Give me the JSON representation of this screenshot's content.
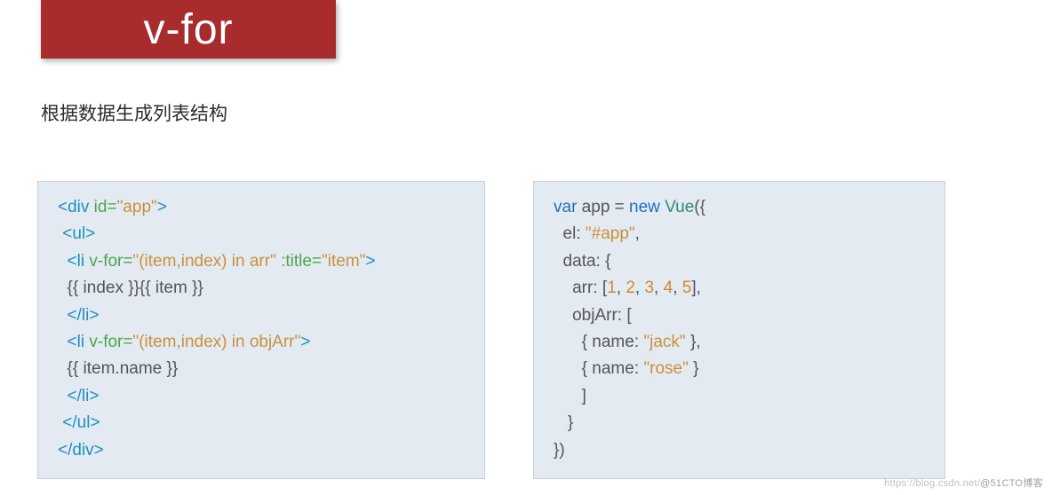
{
  "title": "v-for",
  "subtitle": "根据数据生成列表结构",
  "code_left": {
    "l1_open": "<div ",
    "l1_attr": "id=",
    "l1_str": "\"app\"",
    "l1_close": ">",
    "l2": " <ul>",
    "l3_open": "  <li ",
    "l3_attr1": "v-for=",
    "l3_str1": "\"(item,index) in arr\"",
    "l3_sp": " ",
    "l3_attr2": ":title=",
    "l3_str2": "\"item\"",
    "l3_close": ">",
    "l4": "  {{ index }}{{ item }}",
    "l5": "  </li>",
    "l6_open": "  <li ",
    "l6_attr": "v-for=",
    "l6_str": "\"(item,index) in objArr\"",
    "l6_close": ">",
    "l7": "  {{ item.name }}",
    "l8": "  </li>",
    "l9": " </ul>",
    "l10": "</div>"
  },
  "code_right": {
    "l1_kw1": "var",
    "l1_sp1": " app = ",
    "l1_kw2": "new",
    "l1_sp2": " ",
    "l1_cls": "Vue",
    "l1_end": "({",
    "l2_a": "  el: ",
    "l2_b": "\"#app\"",
    "l2_c": ",",
    "l3": "  data: {",
    "l4_a": "    arr: [",
    "l4_n1": "1",
    "l4_c1": ", ",
    "l4_n2": "2",
    "l4_c2": ", ",
    "l4_n3": "3",
    "l4_c3": ", ",
    "l4_n4": "4",
    "l4_c4": ", ",
    "l4_n5": "5",
    "l4_end": "],",
    "l5": "    objArr: [",
    "l6_a": "      { name: ",
    "l6_b": "\"jack\"",
    "l6_c": " },",
    "l7_a": "      { name: ",
    "l7_b": "\"rose\"",
    "l7_c": " }",
    "l8": "      ]",
    "l9": "   }",
    "l10": "})"
  },
  "watermark_left": "https://blog.csdn.net/",
  "watermark_right": "@51CTO博客"
}
